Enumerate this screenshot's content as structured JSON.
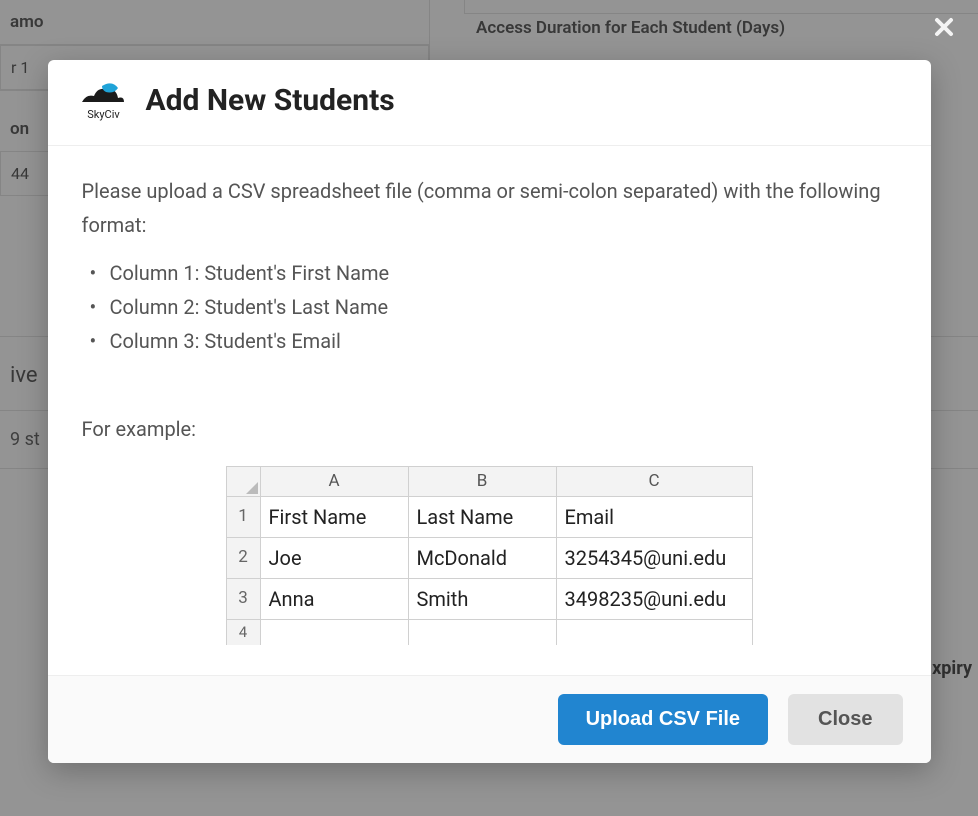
{
  "background": {
    "left_label_1_fragment": "amo",
    "left_value_1_fragment": "r 1",
    "left_label_2_fragment": "on",
    "left_value_2_fragment": "44",
    "section2_label_fragment": "ive",
    "section2_value_fragment": "9 st",
    "expiry_fragment": "xpiry",
    "right_access_label": "Access Duration for Each Student (Days)"
  },
  "modal": {
    "logo_caption": "SkyCiv",
    "title": "Add New Students",
    "instructions": "Please upload a CSV spreadsheet file (comma or semi-colon separated) with the following format:",
    "format_items": [
      "Column 1: Student's First Name",
      "Column 2: Student's Last Name",
      "Column 3: Student's Email"
    ],
    "example_label": "For example:",
    "example_table": {
      "col_headers": [
        "A",
        "B",
        "C"
      ],
      "row_numbers": [
        "1",
        "2",
        "3",
        "4"
      ],
      "rows": [
        {
          "first": "First Name",
          "last": "Last Name",
          "email": "Email"
        },
        {
          "first": "Joe",
          "last": "McDonald",
          "email": "3254345@uni.edu"
        },
        {
          "first": "Anna",
          "last": "Smith",
          "email": "3498235@uni.edu"
        }
      ]
    },
    "upload_button": "Upload CSV File",
    "close_button": "Close"
  }
}
